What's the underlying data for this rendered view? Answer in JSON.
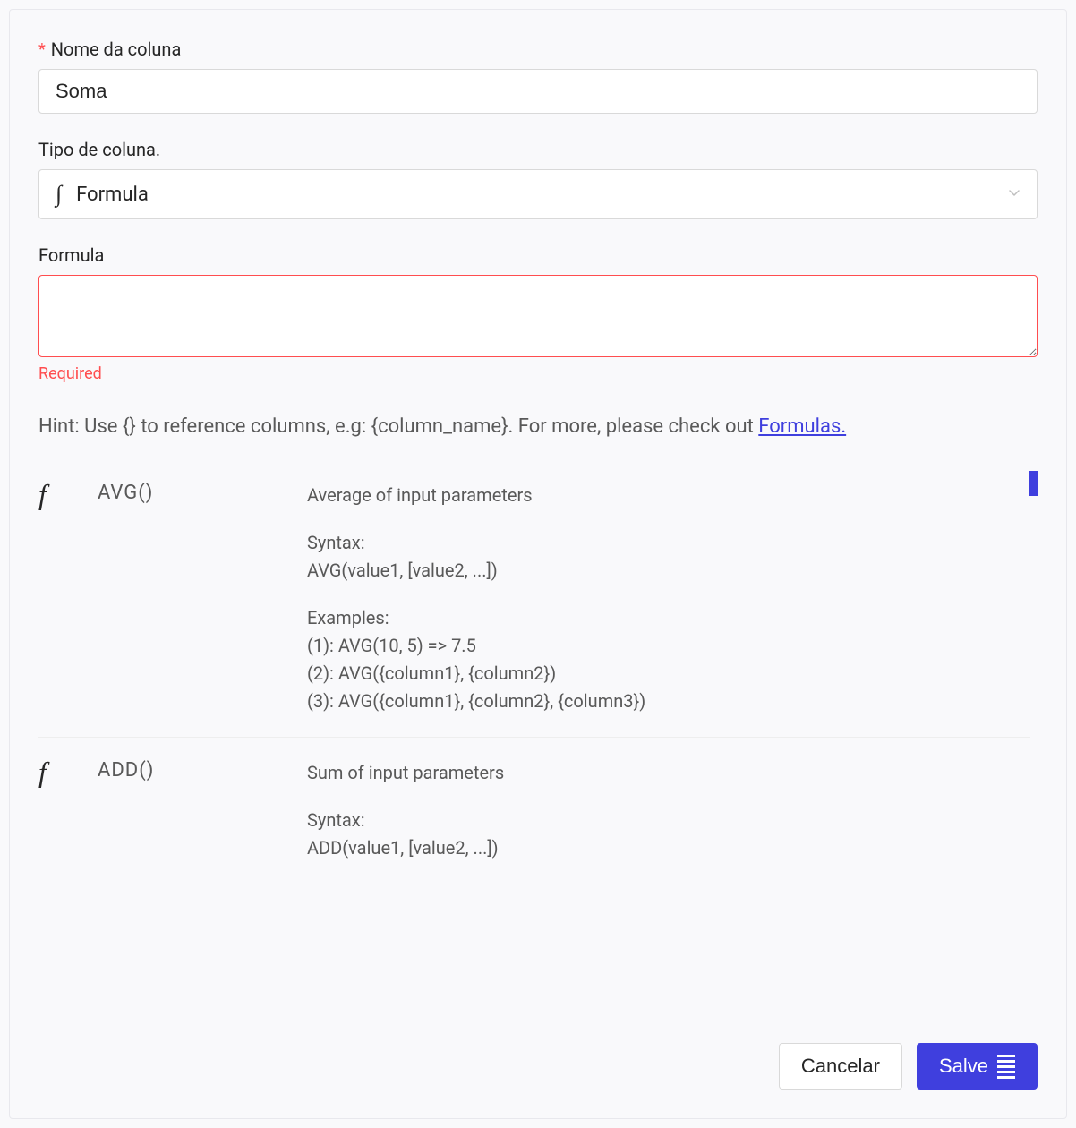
{
  "fields": {
    "column_name": {
      "label": "Nome da coluna",
      "value": "Soma",
      "required": true
    },
    "column_type": {
      "label": "Tipo de coluna.",
      "selected": "Formula"
    },
    "formula": {
      "label": "Formula",
      "value": "",
      "error": "Required"
    }
  },
  "hint": {
    "text_before": "Hint: Use {} to reference columns, e.g: {column_name}. For more, please check out ",
    "link_text": "Formulas."
  },
  "functions": [
    {
      "name": "AVG()",
      "description": "Average of input parameters",
      "syntax_label": "Syntax:",
      "syntax": "AVG(value1, [value2, ...])",
      "examples_label": "Examples:",
      "examples": [
        "(1): AVG(10, 5) => 7.5",
        "(2): AVG({column1}, {column2})",
        "(3): AVG({column1}, {column2}, {column3})"
      ]
    },
    {
      "name": "ADD()",
      "description": "Sum of input parameters",
      "syntax_label": "Syntax:",
      "syntax": "ADD(value1, [value2, ...])",
      "examples_label": "",
      "examples": []
    }
  ],
  "footer": {
    "cancel": "Cancelar",
    "save": "Salve"
  }
}
